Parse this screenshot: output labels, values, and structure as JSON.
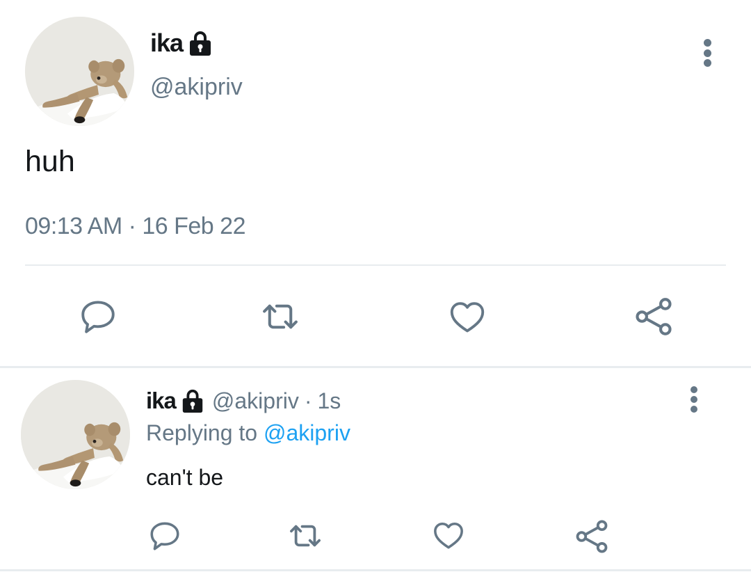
{
  "main_tweet": {
    "display_name": "ika",
    "handle": "@akipriv",
    "text": "huh",
    "timestamp": "09:13 AM · 16 Feb 22",
    "lock_icon": "lock-icon",
    "menu_icon": "more-vertical-icon"
  },
  "reply_tweet": {
    "display_name": "ika",
    "handle": "@akipriv",
    "separator": "·",
    "time_ago": "1s",
    "replying_label": "Replying to",
    "replying_handle": "@akipriv",
    "text": "can't be",
    "lock_icon": "lock-icon",
    "menu_icon": "more-vertical-icon"
  },
  "actions": [
    "reply-icon",
    "retweet-icon",
    "like-icon",
    "share-icon"
  ],
  "colors": {
    "text": "#14171a",
    "muted": "#657786",
    "link": "#1da1f2",
    "divider": "#e8ecef"
  }
}
